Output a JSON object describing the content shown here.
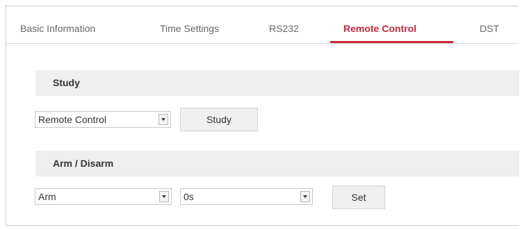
{
  "tabs": [
    {
      "label": "Basic Information"
    },
    {
      "label": "Time Settings"
    },
    {
      "label": "RS232"
    },
    {
      "label": "Remote Control"
    },
    {
      "label": "DST"
    }
  ],
  "active_tab": "Remote Control",
  "study": {
    "title": "Study",
    "select_value": "Remote Control",
    "button_label": "Study"
  },
  "arm_disarm": {
    "title": "Arm / Disarm",
    "mode_value": "Arm",
    "delay_value": "0s",
    "button_label": "Set"
  },
  "colors": {
    "accent": "#c8283a",
    "section_bg": "#efefef"
  },
  "icons": {
    "dropdown": "chevron-down-icon"
  }
}
